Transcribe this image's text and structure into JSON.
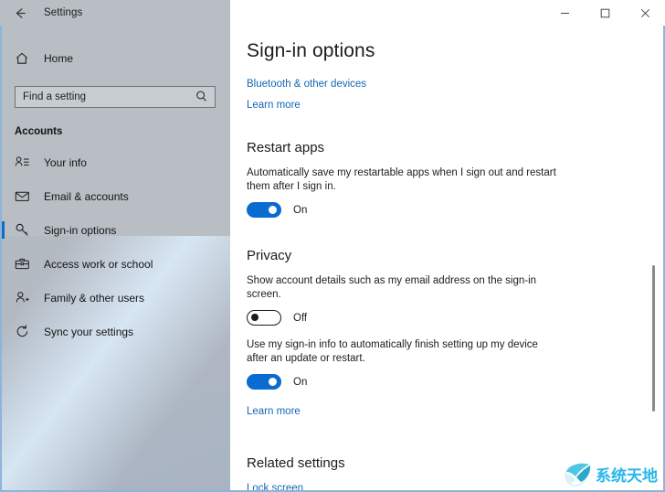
{
  "window": {
    "title": "Settings",
    "back_icon": "back-arrow-icon",
    "controls": {
      "minimize": "minimize-icon",
      "maximize": "maximize-icon",
      "close": "close-icon"
    }
  },
  "sidebar": {
    "home": {
      "label": "Home",
      "icon": "home-icon"
    },
    "search": {
      "placeholder": "Find a setting",
      "icon": "search-icon"
    },
    "group_header": "Accounts",
    "items": [
      {
        "label": "Your info",
        "icon": "person-info-icon",
        "selected": false
      },
      {
        "label": "Email & accounts",
        "icon": "mail-icon",
        "selected": false
      },
      {
        "label": "Sign-in options",
        "icon": "key-icon",
        "selected": true
      },
      {
        "label": "Access work or school",
        "icon": "briefcase-icon",
        "selected": false
      },
      {
        "label": "Family & other users",
        "icon": "person-add-icon",
        "selected": false
      },
      {
        "label": "Sync your settings",
        "icon": "sync-icon",
        "selected": false
      }
    ],
    "accent_color": "#0d6ec4"
  },
  "main": {
    "page_title": "Sign-in options",
    "top_links": [
      {
        "label": "Bluetooth & other devices"
      },
      {
        "label": "Learn more"
      }
    ],
    "restart_apps": {
      "heading": "Restart apps",
      "description": "Automatically save my restartable apps when I sign out and restart them after I sign in.",
      "toggle": {
        "state": "on",
        "label": "On"
      }
    },
    "privacy": {
      "heading": "Privacy",
      "setting_1": {
        "description": "Show account details such as my email address on the sign-in screen.",
        "toggle": {
          "state": "off",
          "label": "Off"
        }
      },
      "setting_2": {
        "description": "Use my sign-in info to automatically finish setting up my device after an update or restart.",
        "toggle": {
          "state": "on",
          "label": "On"
        }
      },
      "learn_more": "Learn more"
    },
    "related_settings": {
      "heading": "Related settings",
      "links": [
        {
          "label": "Lock screen"
        }
      ]
    },
    "toggle_on_color": "#0a6bd0",
    "link_color": "#1267b5"
  },
  "watermark": {
    "text": "系统天地",
    "logo_icon": "sphere-swoosh-logo-icon",
    "color": "#27b7e8"
  }
}
